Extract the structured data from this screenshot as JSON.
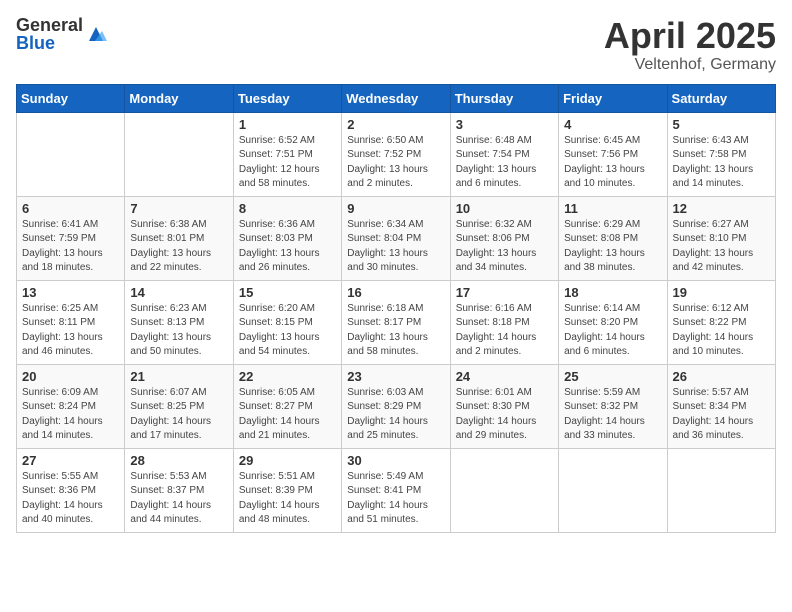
{
  "logo": {
    "general": "General",
    "blue": "Blue"
  },
  "title": {
    "month": "April 2025",
    "location": "Veltenhof, Germany"
  },
  "weekdays": [
    "Sunday",
    "Monday",
    "Tuesday",
    "Wednesday",
    "Thursday",
    "Friday",
    "Saturday"
  ],
  "weeks": [
    [
      {
        "day": "",
        "info": ""
      },
      {
        "day": "",
        "info": ""
      },
      {
        "day": "1",
        "info": "Sunrise: 6:52 AM\nSunset: 7:51 PM\nDaylight: 12 hours\nand 58 minutes."
      },
      {
        "day": "2",
        "info": "Sunrise: 6:50 AM\nSunset: 7:52 PM\nDaylight: 13 hours\nand 2 minutes."
      },
      {
        "day": "3",
        "info": "Sunrise: 6:48 AM\nSunset: 7:54 PM\nDaylight: 13 hours\nand 6 minutes."
      },
      {
        "day": "4",
        "info": "Sunrise: 6:45 AM\nSunset: 7:56 PM\nDaylight: 13 hours\nand 10 minutes."
      },
      {
        "day": "5",
        "info": "Sunrise: 6:43 AM\nSunset: 7:58 PM\nDaylight: 13 hours\nand 14 minutes."
      }
    ],
    [
      {
        "day": "6",
        "info": "Sunrise: 6:41 AM\nSunset: 7:59 PM\nDaylight: 13 hours\nand 18 minutes."
      },
      {
        "day": "7",
        "info": "Sunrise: 6:38 AM\nSunset: 8:01 PM\nDaylight: 13 hours\nand 22 minutes."
      },
      {
        "day": "8",
        "info": "Sunrise: 6:36 AM\nSunset: 8:03 PM\nDaylight: 13 hours\nand 26 minutes."
      },
      {
        "day": "9",
        "info": "Sunrise: 6:34 AM\nSunset: 8:04 PM\nDaylight: 13 hours\nand 30 minutes."
      },
      {
        "day": "10",
        "info": "Sunrise: 6:32 AM\nSunset: 8:06 PM\nDaylight: 13 hours\nand 34 minutes."
      },
      {
        "day": "11",
        "info": "Sunrise: 6:29 AM\nSunset: 8:08 PM\nDaylight: 13 hours\nand 38 minutes."
      },
      {
        "day": "12",
        "info": "Sunrise: 6:27 AM\nSunset: 8:10 PM\nDaylight: 13 hours\nand 42 minutes."
      }
    ],
    [
      {
        "day": "13",
        "info": "Sunrise: 6:25 AM\nSunset: 8:11 PM\nDaylight: 13 hours\nand 46 minutes."
      },
      {
        "day": "14",
        "info": "Sunrise: 6:23 AM\nSunset: 8:13 PM\nDaylight: 13 hours\nand 50 minutes."
      },
      {
        "day": "15",
        "info": "Sunrise: 6:20 AM\nSunset: 8:15 PM\nDaylight: 13 hours\nand 54 minutes."
      },
      {
        "day": "16",
        "info": "Sunrise: 6:18 AM\nSunset: 8:17 PM\nDaylight: 13 hours\nand 58 minutes."
      },
      {
        "day": "17",
        "info": "Sunrise: 6:16 AM\nSunset: 8:18 PM\nDaylight: 14 hours\nand 2 minutes."
      },
      {
        "day": "18",
        "info": "Sunrise: 6:14 AM\nSunset: 8:20 PM\nDaylight: 14 hours\nand 6 minutes."
      },
      {
        "day": "19",
        "info": "Sunrise: 6:12 AM\nSunset: 8:22 PM\nDaylight: 14 hours\nand 10 minutes."
      }
    ],
    [
      {
        "day": "20",
        "info": "Sunrise: 6:09 AM\nSunset: 8:24 PM\nDaylight: 14 hours\nand 14 minutes."
      },
      {
        "day": "21",
        "info": "Sunrise: 6:07 AM\nSunset: 8:25 PM\nDaylight: 14 hours\nand 17 minutes."
      },
      {
        "day": "22",
        "info": "Sunrise: 6:05 AM\nSunset: 8:27 PM\nDaylight: 14 hours\nand 21 minutes."
      },
      {
        "day": "23",
        "info": "Sunrise: 6:03 AM\nSunset: 8:29 PM\nDaylight: 14 hours\nand 25 minutes."
      },
      {
        "day": "24",
        "info": "Sunrise: 6:01 AM\nSunset: 8:30 PM\nDaylight: 14 hours\nand 29 minutes."
      },
      {
        "day": "25",
        "info": "Sunrise: 5:59 AM\nSunset: 8:32 PM\nDaylight: 14 hours\nand 33 minutes."
      },
      {
        "day": "26",
        "info": "Sunrise: 5:57 AM\nSunset: 8:34 PM\nDaylight: 14 hours\nand 36 minutes."
      }
    ],
    [
      {
        "day": "27",
        "info": "Sunrise: 5:55 AM\nSunset: 8:36 PM\nDaylight: 14 hours\nand 40 minutes."
      },
      {
        "day": "28",
        "info": "Sunrise: 5:53 AM\nSunset: 8:37 PM\nDaylight: 14 hours\nand 44 minutes."
      },
      {
        "day": "29",
        "info": "Sunrise: 5:51 AM\nSunset: 8:39 PM\nDaylight: 14 hours\nand 48 minutes."
      },
      {
        "day": "30",
        "info": "Sunrise: 5:49 AM\nSunset: 8:41 PM\nDaylight: 14 hours\nand 51 minutes."
      },
      {
        "day": "",
        "info": ""
      },
      {
        "day": "",
        "info": ""
      },
      {
        "day": "",
        "info": ""
      }
    ]
  ]
}
